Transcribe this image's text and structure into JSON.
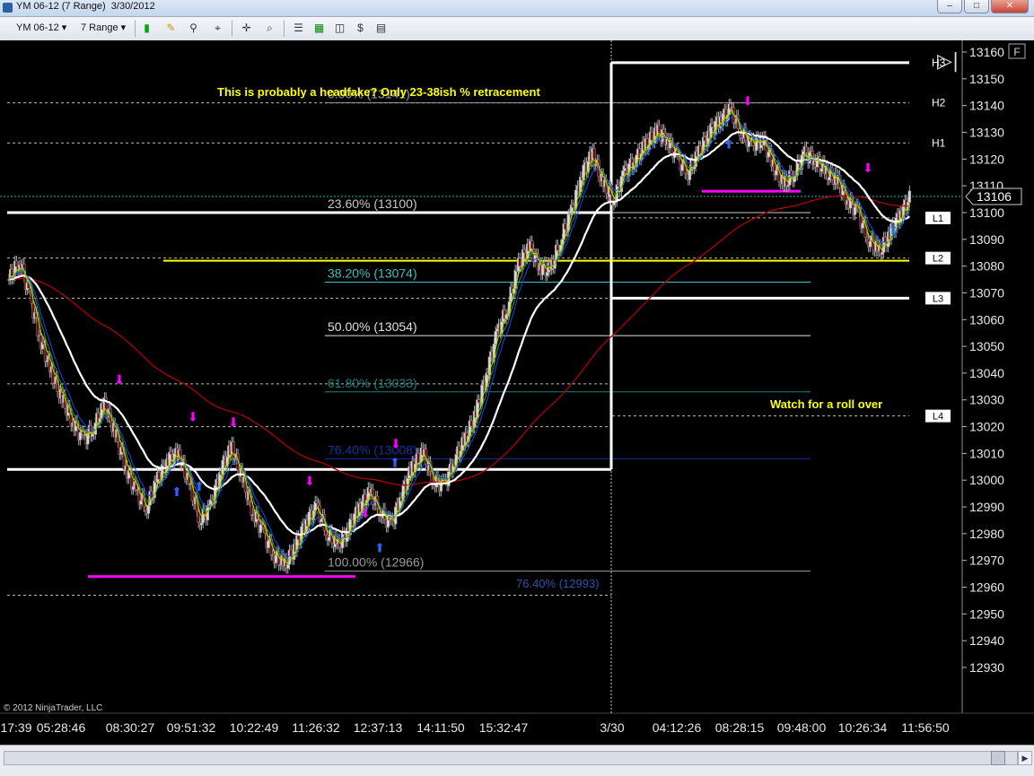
{
  "window": {
    "title": "YM 06-12 (7 Range)  3/30/2012",
    "min": "‒",
    "max": "□",
    "close": "✕"
  },
  "toolbar": {
    "instrument": "YM 06-12",
    "period": "7 Range",
    "dropdown": "▾"
  },
  "icons": [
    "bar-style-icon",
    "pencil-draw-icon",
    "pin-icon",
    "crosshair-icon",
    "zoom-icon",
    "properties-icon",
    "indicators-icon",
    "strategies-icon",
    "data-box-icon",
    "order-entry-icon"
  ],
  "scroll": {
    "left": "◀",
    "right": "▶"
  },
  "colors": {
    "bg": "#000000",
    "accent": "#ffff00",
    "magenta": "#ff00ff",
    "ema_red": "#b00000",
    "last_price": "#00c0c0"
  },
  "chart_data": {
    "type": "candlestick",
    "ylim": [
      12925,
      13173
    ],
    "yticks": [
      12930,
      12940,
      12950,
      12960,
      12970,
      12980,
      12990,
      13000,
      13010,
      13020,
      13030,
      13040,
      13050,
      13060,
      13070,
      13080,
      13090,
      13100,
      13110,
      13120,
      13130,
      13140,
      13150,
      13160
    ],
    "xticks": [
      "17:39",
      "05:28:46",
      "08:30:27",
      "09:51:32",
      "10:22:49",
      "11:26:32",
      "12:37:13",
      "14:11:50",
      "15:32:47",
      "3/30",
      "04:12:26",
      "08:28:15",
      "09:48:00",
      "10:26:34",
      "11:56:50"
    ],
    "last_price": "13106",
    "price_series": [
      13075,
      13082,
      13068,
      13052,
      13040,
      13030,
      13022,
      13015,
      13020,
      13028,
      13018,
      13005,
      12995,
      12990,
      13000,
      13008,
      13010,
      12998,
      12985,
      12990,
      13005,
      13012,
      13000,
      12988,
      12980,
      12972,
      12968,
      12975,
      12985,
      12990,
      12980,
      12975,
      12982,
      12990,
      12995,
      12988,
      12983,
      12995,
      13005,
      13010,
      13000,
      12998,
      13008,
      13015,
      13025,
      13040,
      13055,
      13065,
      13080,
      13088,
      13080,
      13078,
      13090,
      13100,
      13115,
      13122,
      13110,
      13105,
      13115,
      13120,
      13125,
      13130,
      13128,
      13120,
      13115,
      13122,
      13130,
      13135,
      13138,
      13130,
      13125,
      13128,
      13118,
      13110,
      13115,
      13122,
      13120,
      13115,
      13112,
      13105,
      13100,
      13090,
      13085,
      13092,
      13100,
      13106
    ],
    "fib_levels": [
      {
        "label": "0.00% (13141)",
        "value": 13141,
        "color": "#9a9a9a"
      },
      {
        "label": "23.60% (13100)",
        "value": 13100,
        "color": "#c8c8c8"
      },
      {
        "label": "38.20% (13074)",
        "value": 13074,
        "color": "#40c0c0"
      },
      {
        "label": "50.00% (13054)",
        "value": 13054,
        "color": "#e0e0e0"
      },
      {
        "label": "61.80% (13033)",
        "value": 13033,
        "color": "#208080"
      },
      {
        "label": "76.40% (13008)",
        "value": 13008,
        "color": "#1030a0"
      },
      {
        "label": "100.00% (12966)",
        "value": 12966,
        "color": "#9a9a9a"
      }
    ],
    "pivots": [
      {
        "label": "H3",
        "value": 13156
      },
      {
        "label": "H2",
        "value": 13141
      },
      {
        "label": "H1",
        "value": 13126
      },
      {
        "label": "L1",
        "value": 13098
      },
      {
        "label": "L2",
        "value": 13083
      },
      {
        "label": "L3",
        "value": 13068
      },
      {
        "label": "L4",
        "value": 13024
      }
    ],
    "overlap_label": "76.40% (12993)",
    "annotations": {
      "top": "This is probably a headfake?  Only 23-38ish % retracement",
      "right": "Watch for a roll over",
      "copyright": "© 2012 NinjaTrader, LLC",
      "panel_button": "F"
    }
  }
}
